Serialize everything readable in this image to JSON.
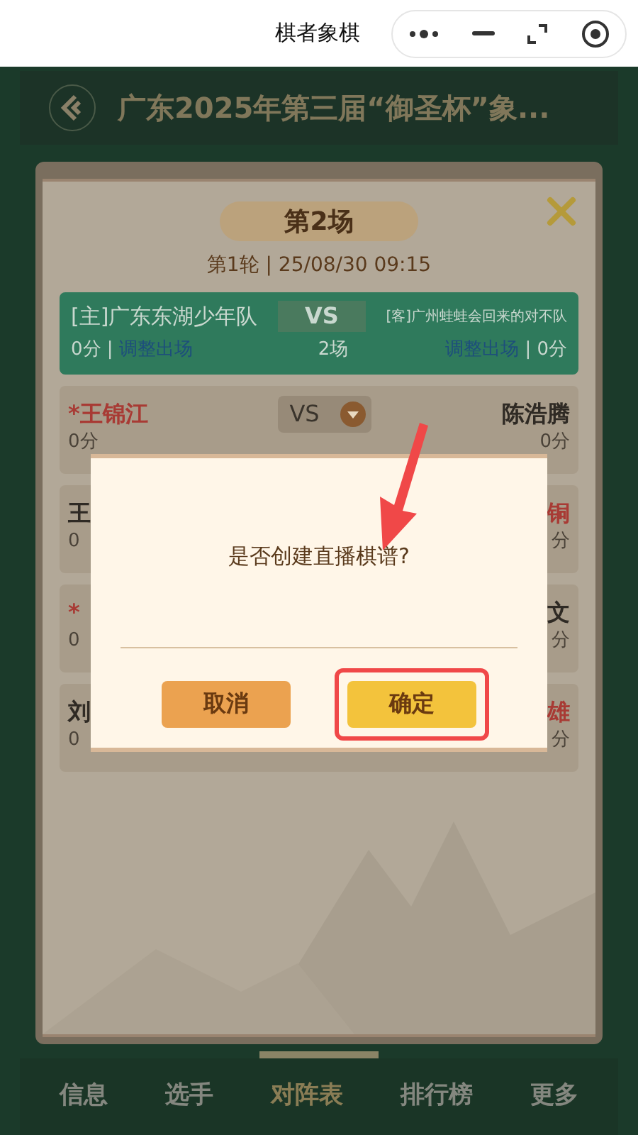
{
  "app_bar": {
    "title": "棋者象棋"
  },
  "header": {
    "title": "广东2025年第三届“御圣杯”象..."
  },
  "match": {
    "title": "第2场",
    "subtitle": "第1轮 | 25/08/30 09:15",
    "vs": "VS",
    "games": "2场",
    "home": {
      "name": "[主]广东东湖少年队",
      "score": "0分 |",
      "link": "调整出场"
    },
    "away": {
      "name": "[客]广州蛙蛙会回来的对不队",
      "score": "| 0分",
      "link": "调整出场"
    }
  },
  "boards": [
    {
      "left": "*王锦江",
      "left_score": "0分",
      "right": "陈浩腾",
      "right_score": "0分",
      "left_red": true,
      "right_red": false,
      "vs": "VS"
    },
    {
      "left": "王",
      "left_score": "0",
      "right": "铜",
      "right_score": "分",
      "left_red": false,
      "right_red": true
    },
    {
      "left": "*",
      "left_score": "0",
      "right": "文",
      "right_score": "分",
      "left_red": true,
      "right_red": false
    },
    {
      "left": "刘",
      "left_score": "0",
      "right": "雄",
      "right_score": "分",
      "left_red": false,
      "right_red": true
    }
  ],
  "dialog": {
    "message": "是否创建直播棋谱?",
    "buttons": [
      {
        "label": "取消",
        "kind": "cancel",
        "highlighted": false
      },
      {
        "label": "确定",
        "kind": "confirm",
        "highlighted": true
      }
    ]
  },
  "tabs": [
    {
      "label": "信息",
      "selected": false
    },
    {
      "label": "选手",
      "selected": false
    },
    {
      "label": "对阵表",
      "selected": true
    },
    {
      "label": "排行榜",
      "selected": false
    },
    {
      "label": "更多",
      "selected": false
    }
  ]
}
